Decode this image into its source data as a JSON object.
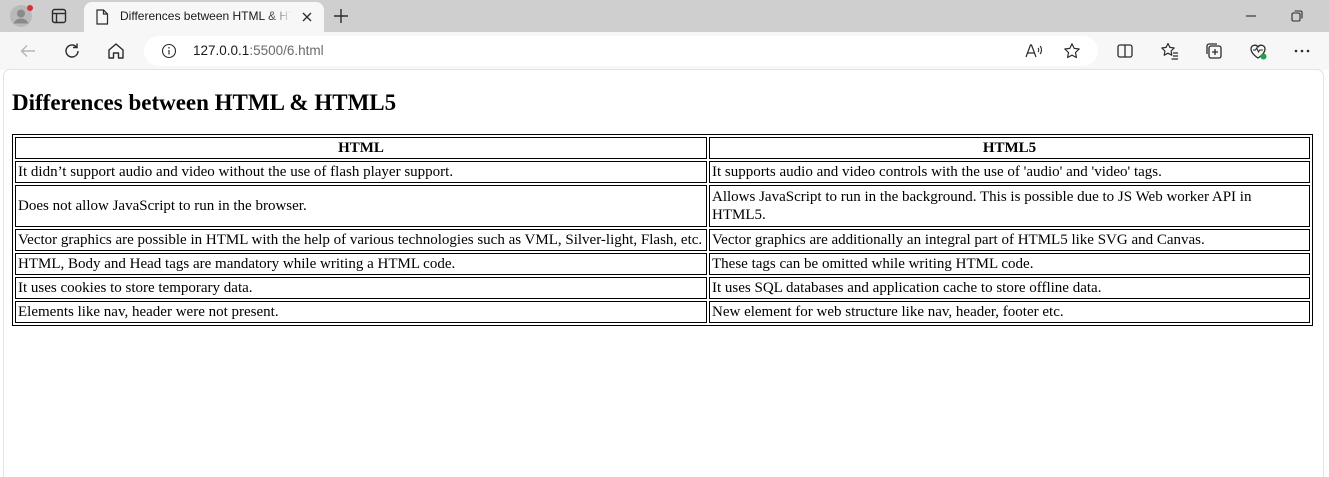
{
  "browser": {
    "tab": {
      "title": "Differences between HTML & HTML5"
    },
    "address": {
      "host": "127.0.0.1",
      "rest": ":5500/6.html"
    }
  },
  "page": {
    "heading": "Differences between HTML & HTML5",
    "table": {
      "headers": [
        "HTML",
        "HTML5"
      ],
      "rows": [
        [
          "It didn’t support audio and video without the use of flash player support.",
          "It supports audio and video controls with the use of 'audio' and 'video' tags."
        ],
        [
          "Does not allow JavaScript to run in the browser.",
          "Allows JavaScript to run in the background. This is possible due to JS Web worker API in HTML5."
        ],
        [
          "Vector graphics are possible in HTML with the help of various technologies such as VML, Silver-light, Flash, etc.",
          "Vector graphics are additionally an integral part of HTML5 like SVG and Canvas."
        ],
        [
          "HTML, Body and Head tags are mandatory while writing a HTML code.",
          "These tags can be omitted while writing HTML code."
        ],
        [
          "It uses cookies to store temporary data.",
          "It uses SQL databases and application cache to store offline data."
        ],
        [
          "Elements like nav, header were not present.",
          "New element for web structure like nav, header, footer etc."
        ]
      ]
    }
  },
  "icons": [
    "profile-icon",
    "tab-actions-icon",
    "page-icon",
    "close-icon",
    "new-tab-icon",
    "minimize-icon",
    "maximize-icon",
    "back-icon",
    "refresh-icon",
    "home-icon",
    "info-icon",
    "read-aloud-icon",
    "favorite-icon",
    "split-screen-icon",
    "favorites-icon",
    "collections-icon",
    "browser-essentials-icon",
    "more-icon"
  ],
  "colors": {
    "notification": "#d13438",
    "essentials_badge": "#22a045"
  }
}
